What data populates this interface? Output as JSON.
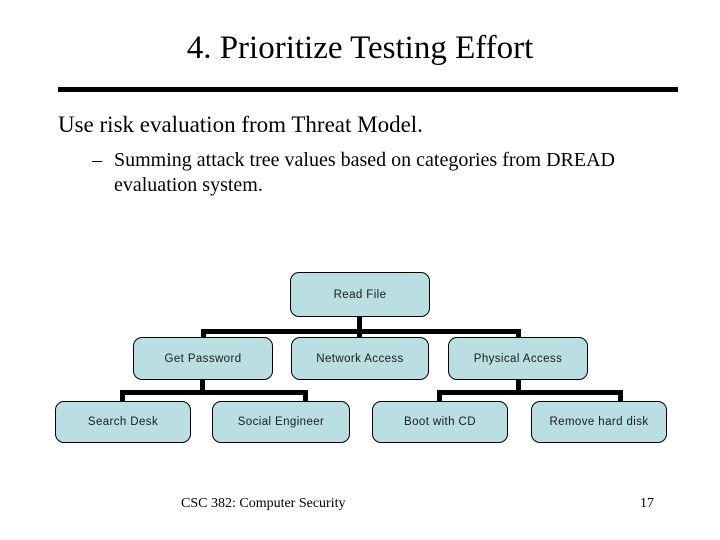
{
  "slide": {
    "title": "4. Prioritize Testing Effort",
    "body": {
      "level1": "Use risk evaluation from Threat Model.",
      "level2_dash": "–",
      "level2": "Summing attack tree values based on categories from DREAD evaluation system."
    },
    "footer": {
      "course": "CSC 382: Computer Security",
      "page_number": "17"
    }
  },
  "diagram": {
    "type": "attack-tree",
    "fill_color": "#b9dfe3",
    "stroke_color": "#000000",
    "nodes": {
      "root": "Read File",
      "level2": [
        "Get Password",
        "Network Access",
        "Physical Access"
      ],
      "level3": [
        "Search Desk",
        "Social Engineer",
        "Boot with CD",
        "Remove hard disk"
      ]
    }
  }
}
